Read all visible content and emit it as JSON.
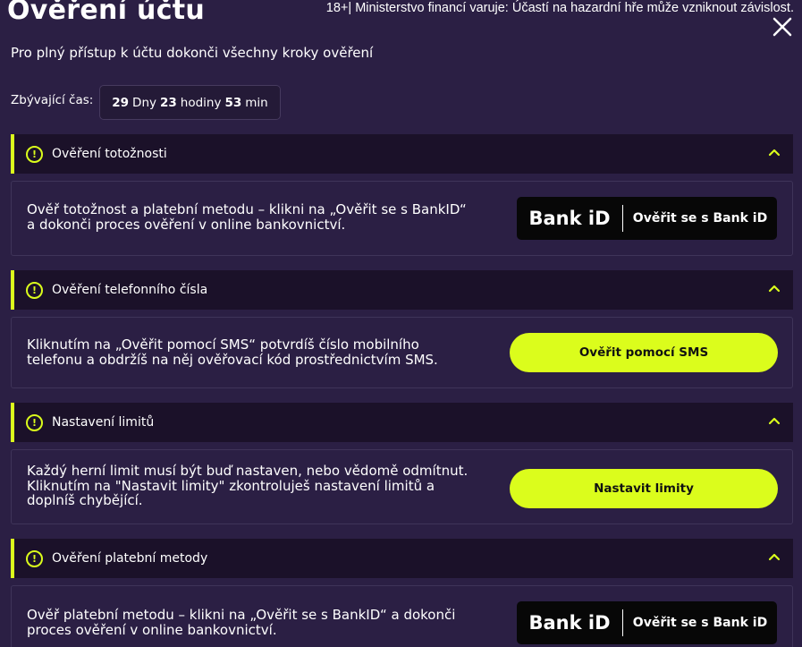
{
  "header": {
    "title": "Ověření účtu",
    "gambling_warning": "18+| Ministerstvo financí varuje: Účastí na hazardní hře může vzniknout závislost.",
    "close_icon": "close-icon"
  },
  "subtitle": "Pro plný přístup k účtu dokonči všechny kroky ověření",
  "timer": {
    "label": "Zbývající čas:",
    "days_value": "29",
    "days_unit": "Dny",
    "hours_value": "23",
    "hours_unit": "hodiny",
    "minutes_value": "53",
    "minutes_unit": "min"
  },
  "colors": {
    "accent": "#dbfd1c",
    "background": "#2b1f44",
    "header_background": "#1b1129",
    "bankid_background": "#070707"
  },
  "sections": [
    {
      "title": "Ověření totožnosti",
      "text_lines": [
        "Ověř totožnost a platební metodu – klikni na „Ověřit se s BankID“",
        "a dokonči proces ověření v online bankovnictví."
      ],
      "button": {
        "type": "bankid",
        "logo": "Bank iD",
        "label": "Ověřit se s Bank iD"
      }
    },
    {
      "title": "Ověření telefonního čísla",
      "text_lines": [
        "Kliknutím na „Ověřit pomocí SMS“ potvrdíš číslo mobilního",
        "telefonu a obdržíš na něj ověřovací kód prostřednictvím SMS."
      ],
      "button": {
        "type": "primary",
        "label": "Ověřit pomocí SMS"
      }
    },
    {
      "title": "Nastavení limitů",
      "text_lines": [
        "Každý herní limit musí být buď nastaven, nebo vědomě odmítnut.",
        "Kliknutím na \"Nastavit limity\" zkontroluješ nastavení limitů a",
        "doplníš chybějící."
      ],
      "button": {
        "type": "primary",
        "label": "Nastavit limity"
      }
    },
    {
      "title": "Ověření platební metody",
      "text_lines": [
        "Ověř platební metodu – klikni na „Ověřit se s BankID“ a dokonči",
        "proces ověření v online bankovnictví."
      ],
      "button": {
        "type": "bankid",
        "logo": "Bank iD",
        "label": "Ověřit se s Bank iD"
      }
    }
  ]
}
